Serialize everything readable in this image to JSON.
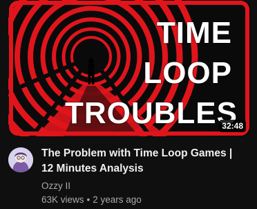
{
  "thumbnail": {
    "title_lines": [
      "TIME",
      "LOOP",
      "TROUBLES"
    ],
    "duration": "32:48",
    "colors": {
      "frame": "#e0151c",
      "background": "#0a0a0a",
      "text": "#ffffff"
    }
  },
  "video": {
    "title_line1": "The Problem with Time Loop Games |",
    "title_line2": "12 Minutes Analysis",
    "channel": "Ozzy II",
    "views": "63K views",
    "separator": "•",
    "age": "2 years ago"
  },
  "avatar": {
    "icon": "channel-avatar-illustration"
  }
}
